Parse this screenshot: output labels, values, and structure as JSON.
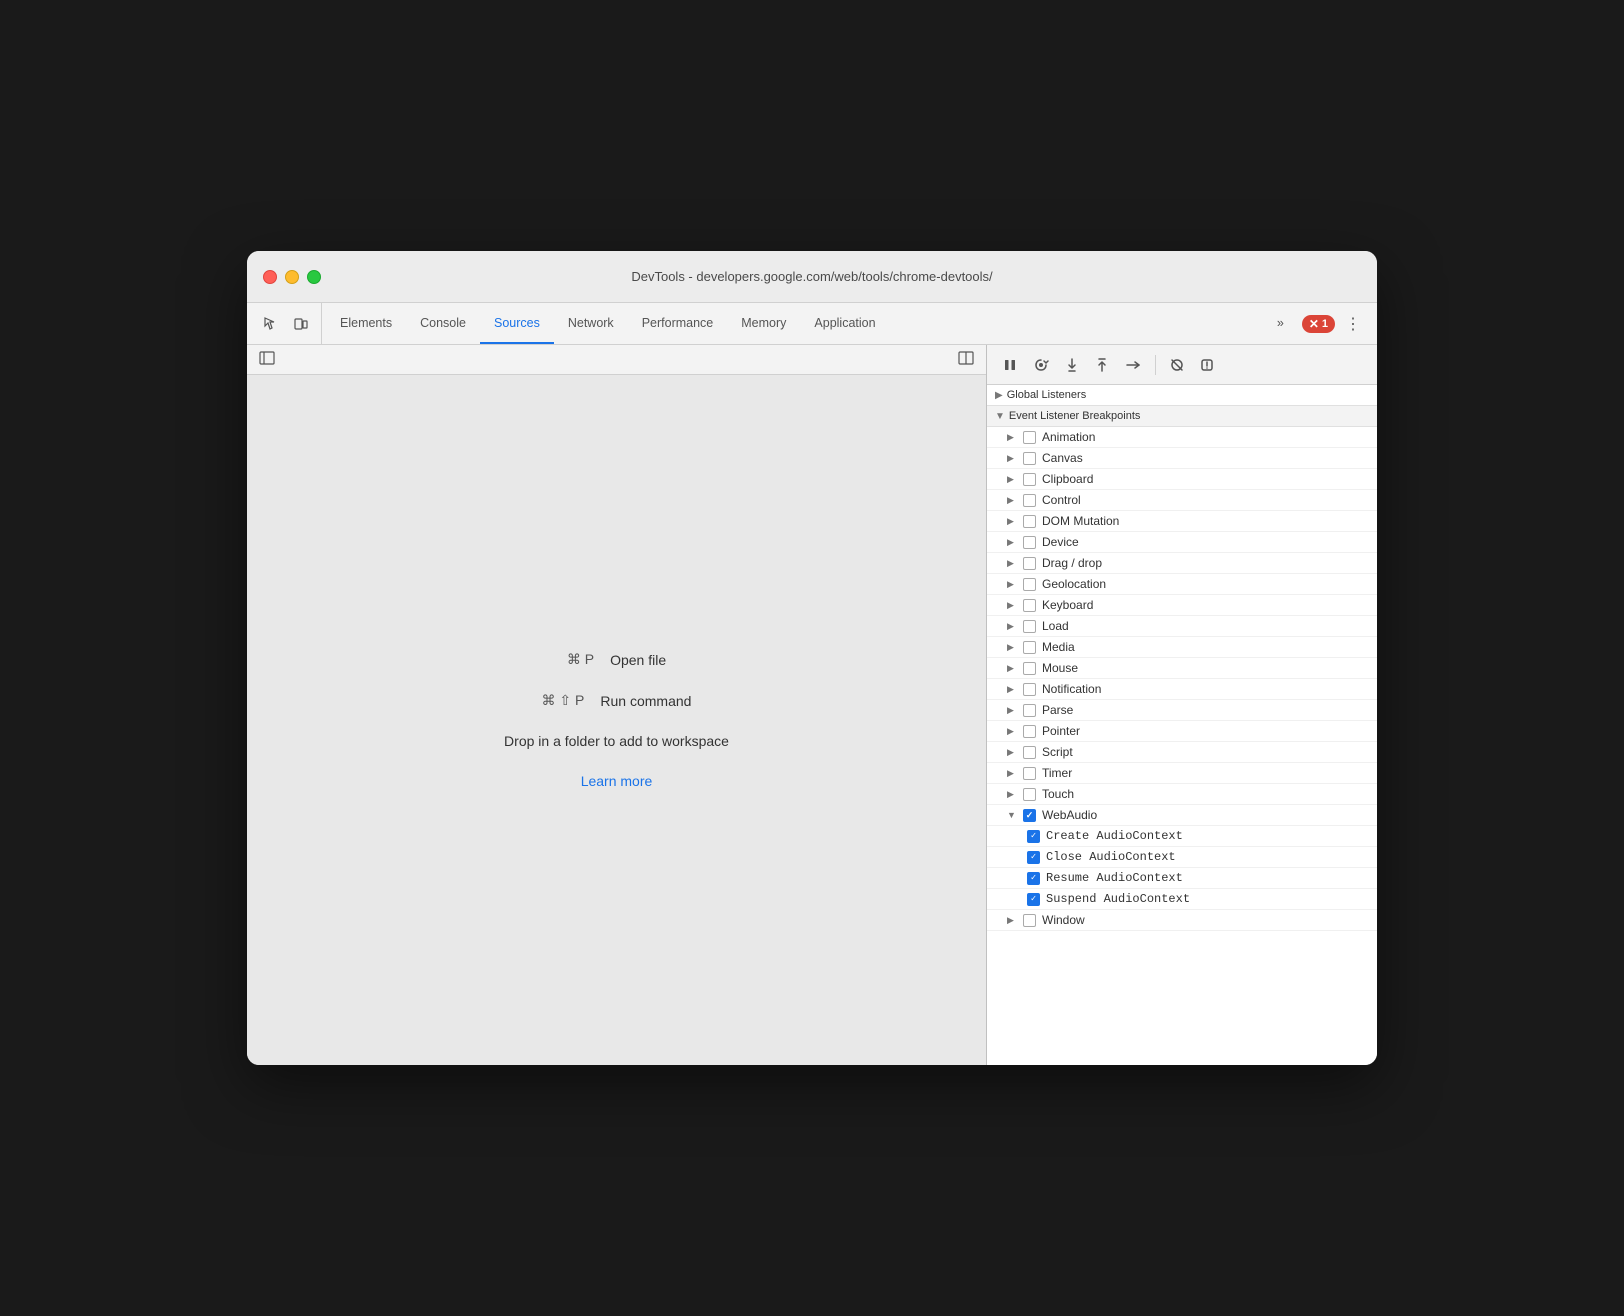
{
  "window": {
    "title": "DevTools - developers.google.com/web/tools/chrome-devtools/"
  },
  "tabs": [
    {
      "id": "elements",
      "label": "Elements",
      "active": false
    },
    {
      "id": "console",
      "label": "Console",
      "active": false
    },
    {
      "id": "sources",
      "label": "Sources",
      "active": true
    },
    {
      "id": "network",
      "label": "Network",
      "active": false
    },
    {
      "id": "performance",
      "label": "Performance",
      "active": false
    },
    {
      "id": "memory",
      "label": "Memory",
      "active": false
    },
    {
      "id": "application",
      "label": "Application",
      "active": false
    }
  ],
  "error_badge": "1",
  "sources_panel": {
    "shortcut1_key": "⌘ P",
    "shortcut1_desc": "Open file",
    "shortcut2_key": "⌘ ⇧ P",
    "shortcut2_desc": "Run command",
    "drop_text": "Drop in a folder to add to workspace",
    "learn_more": "Learn more"
  },
  "debugger": {
    "sections": {
      "global_listeners": "Global Listeners",
      "event_listener_breakpoints": "Event Listener Breakpoints"
    },
    "breakpoints": [
      {
        "id": "animation",
        "label": "Animation",
        "checked": false,
        "expanded": false
      },
      {
        "id": "canvas",
        "label": "Canvas",
        "checked": false,
        "expanded": false
      },
      {
        "id": "clipboard",
        "label": "Clipboard",
        "checked": false,
        "expanded": false
      },
      {
        "id": "control",
        "label": "Control",
        "checked": false,
        "expanded": false
      },
      {
        "id": "dom-mutation",
        "label": "DOM Mutation",
        "checked": false,
        "expanded": false
      },
      {
        "id": "device",
        "label": "Device",
        "checked": false,
        "expanded": false
      },
      {
        "id": "drag-drop",
        "label": "Drag / drop",
        "checked": false,
        "expanded": false
      },
      {
        "id": "geolocation",
        "label": "Geolocation",
        "checked": false,
        "expanded": false
      },
      {
        "id": "keyboard",
        "label": "Keyboard",
        "checked": false,
        "expanded": false
      },
      {
        "id": "load",
        "label": "Load",
        "checked": false,
        "expanded": false
      },
      {
        "id": "media",
        "label": "Media",
        "checked": false,
        "expanded": false
      },
      {
        "id": "mouse",
        "label": "Mouse",
        "checked": false,
        "expanded": false
      },
      {
        "id": "notification",
        "label": "Notification",
        "checked": false,
        "expanded": false
      },
      {
        "id": "parse",
        "label": "Parse",
        "checked": false,
        "expanded": false
      },
      {
        "id": "pointer",
        "label": "Pointer",
        "checked": false,
        "expanded": false
      },
      {
        "id": "script",
        "label": "Script",
        "checked": false,
        "expanded": false
      },
      {
        "id": "timer",
        "label": "Timer",
        "checked": false,
        "expanded": false
      },
      {
        "id": "touch",
        "label": "Touch",
        "checked": false,
        "expanded": false
      },
      {
        "id": "webaudio",
        "label": "WebAudio",
        "checked": true,
        "expanded": true
      }
    ],
    "webaudio_children": [
      {
        "label": "Create AudioContext",
        "checked": true
      },
      {
        "label": "Close AudioContext",
        "checked": true
      },
      {
        "label": "Resume AudioContext",
        "checked": true
      },
      {
        "label": "Suspend AudioContext",
        "checked": true
      }
    ],
    "window_bp": {
      "label": "Window",
      "checked": false,
      "expanded": false
    }
  }
}
